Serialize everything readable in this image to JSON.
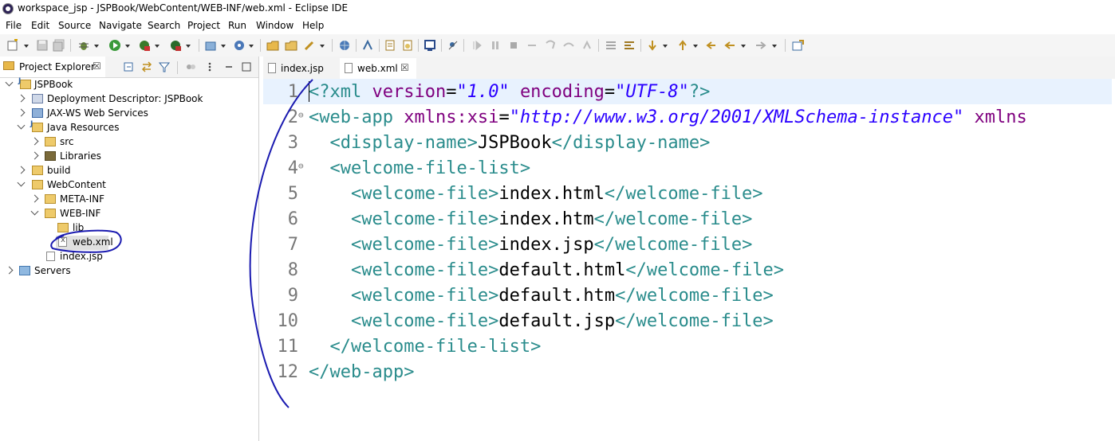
{
  "window": {
    "title": "workspace_jsp - JSPBook/WebContent/WEB-INF/web.xml - Eclipse IDE"
  },
  "menu": [
    "File",
    "Edit",
    "Source",
    "Navigate",
    "Search",
    "Project",
    "Run",
    "Window",
    "Help"
  ],
  "explorer": {
    "tab_label": "Project Explorer",
    "close_glyph": "☒",
    "tree": [
      {
        "label": "JSPBook",
        "icon": "project-icon",
        "state": "open"
      },
      {
        "label": "Deployment Descriptor: JSPBook",
        "icon": "deployment-descriptor-icon",
        "state": "closed"
      },
      {
        "label": "JAX-WS Web Services",
        "icon": "web-services-icon",
        "state": "closed"
      },
      {
        "label": "Java Resources",
        "icon": "java-resources-icon",
        "state": "open"
      },
      {
        "label": "src",
        "icon": "source-folder-icon",
        "state": "closed"
      },
      {
        "label": "Libraries",
        "icon": "libraries-icon",
        "state": "closed"
      },
      {
        "label": "build",
        "icon": "folder-icon",
        "state": "closed"
      },
      {
        "label": "WebContent",
        "icon": "folder-icon",
        "state": "open"
      },
      {
        "label": "META-INF",
        "icon": "folder-icon",
        "state": "closed"
      },
      {
        "label": "WEB-INF",
        "icon": "folder-icon",
        "state": "open"
      },
      {
        "label": "lib",
        "icon": "folder-icon",
        "state": "none"
      },
      {
        "label": "web.xml",
        "icon": "xml-file-icon",
        "state": "none"
      },
      {
        "label": "index.jsp",
        "icon": "jsp-file-icon",
        "state": "none"
      },
      {
        "label": "Servers",
        "icon": "servers-icon",
        "state": "closed"
      }
    ]
  },
  "editor": {
    "tabs": [
      {
        "label": "index.jsp",
        "active": false
      },
      {
        "label": "web.xml",
        "active": true
      }
    ],
    "close_glyph": "☒",
    "lines": [
      {
        "n": "1",
        "fold": "",
        "parts": [
          [
            "pi",
            "<?xml "
          ],
          [
            "attr",
            "version"
          ],
          [
            "content",
            "="
          ],
          [
            "val",
            "\"1.0\""
          ],
          [
            "content",
            " "
          ],
          [
            "attr",
            "encoding"
          ],
          [
            "content",
            "="
          ],
          [
            "val",
            "\"UTF-8\""
          ],
          [
            "pi",
            "?>"
          ]
        ]
      },
      {
        "n": "2",
        "fold": "⊖",
        "parts": [
          [
            "tag",
            "<web-app "
          ],
          [
            "attr",
            "xmlns:xsi"
          ],
          [
            "content",
            "="
          ],
          [
            "val",
            "\"http://www.w3.org/2001/XMLSchema-instance\""
          ],
          [
            "content",
            " "
          ],
          [
            "attr",
            "xmlns"
          ]
        ]
      },
      {
        "n": "3",
        "fold": "",
        "parts": [
          [
            "content",
            "  "
          ],
          [
            "tag",
            "<display-name>"
          ],
          [
            "content",
            "JSPBook"
          ],
          [
            "tag",
            "</display-name>"
          ]
        ]
      },
      {
        "n": "4",
        "fold": "⊖",
        "parts": [
          [
            "content",
            "  "
          ],
          [
            "tag",
            "<welcome-file-list>"
          ]
        ]
      },
      {
        "n": "5",
        "fold": "",
        "parts": [
          [
            "content",
            "    "
          ],
          [
            "tag",
            "<welcome-file>"
          ],
          [
            "content",
            "index.html"
          ],
          [
            "tag",
            "</welcome-file>"
          ]
        ]
      },
      {
        "n": "6",
        "fold": "",
        "parts": [
          [
            "content",
            "    "
          ],
          [
            "tag",
            "<welcome-file>"
          ],
          [
            "content",
            "index.htm"
          ],
          [
            "tag",
            "</welcome-file>"
          ]
        ]
      },
      {
        "n": "7",
        "fold": "",
        "parts": [
          [
            "content",
            "    "
          ],
          [
            "tag",
            "<welcome-file>"
          ],
          [
            "content",
            "index.jsp"
          ],
          [
            "tag",
            "</welcome-file>"
          ]
        ]
      },
      {
        "n": "8",
        "fold": "",
        "parts": [
          [
            "content",
            "    "
          ],
          [
            "tag",
            "<welcome-file>"
          ],
          [
            "content",
            "default.html"
          ],
          [
            "tag",
            "</welcome-file>"
          ]
        ]
      },
      {
        "n": "9",
        "fold": "",
        "parts": [
          [
            "content",
            "    "
          ],
          [
            "tag",
            "<welcome-file>"
          ],
          [
            "content",
            "default.htm"
          ],
          [
            "tag",
            "</welcome-file>"
          ]
        ]
      },
      {
        "n": "10",
        "fold": "",
        "parts": [
          [
            "content",
            "    "
          ],
          [
            "tag",
            "<welcome-file>"
          ],
          [
            "content",
            "default.jsp"
          ],
          [
            "tag",
            "</welcome-file>"
          ]
        ]
      },
      {
        "n": "11",
        "fold": "",
        "parts": [
          [
            "content",
            "  "
          ],
          [
            "tag",
            "</welcome-file-list>"
          ]
        ]
      },
      {
        "n": "12",
        "fold": "",
        "parts": [
          [
            "tag",
            "</web-app>"
          ]
        ]
      }
    ]
  },
  "colors": {
    "tag": "#2a8c8c",
    "attr": "#7f007f",
    "value": "#2a00ff",
    "annotation": "#1a1ab0"
  }
}
